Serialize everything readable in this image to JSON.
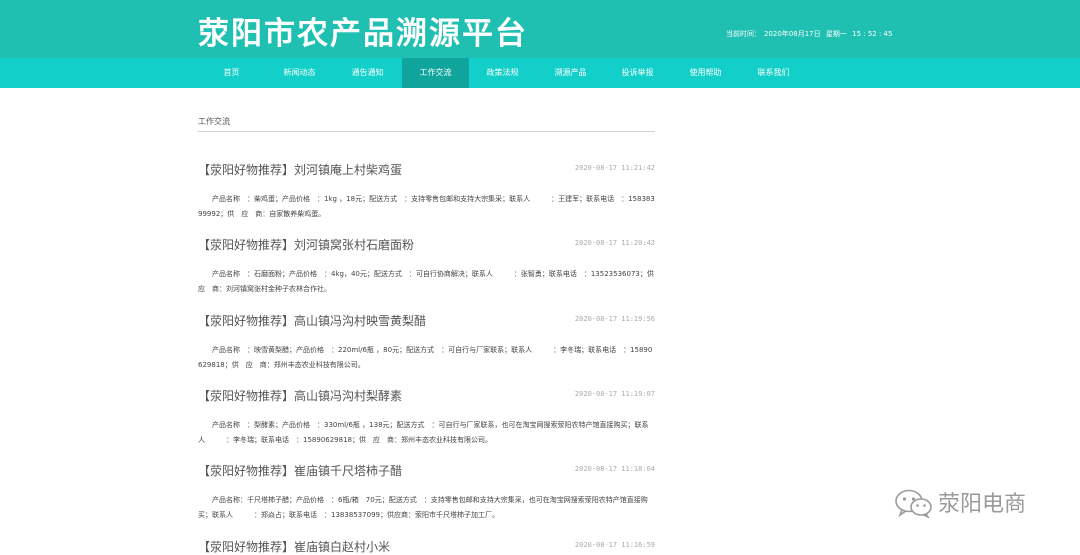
{
  "header": {
    "title": "荥阳市农产品溯源平台",
    "clock_label": "当前时间：",
    "clock_date": "2020年08月17日",
    "clock_weekday": "星期一",
    "clock_time": "15 : 52 : 45"
  },
  "nav": {
    "items": [
      {
        "label": "首页"
      },
      {
        "label": "新闻动态"
      },
      {
        "label": "通告通知"
      },
      {
        "label": "工作交流",
        "active": true
      },
      {
        "label": "政策法规"
      },
      {
        "label": "溯源产品"
      },
      {
        "label": "投诉举报"
      },
      {
        "label": "使用帮助"
      },
      {
        "label": "联系我们"
      }
    ]
  },
  "breadcrumb": "工作交流",
  "articles": [
    {
      "title": "【荥阳好物推荐】刘河镇庵上村柴鸡蛋",
      "time": "2020-08-17 11:21:42",
      "summary": "产品名称　：柴鸡蛋；产品价格　：1kg ，18元；配送方式　：支持零售包邮和支持大宗集采；联系人　　　：王建军；联系电话　：15838399992；供　应　商：自家散养柴鸡蛋。"
    },
    {
      "title": "【荥阳好物推荐】刘河镇窝张村石磨面粉",
      "time": "2020-08-17 11:20:42",
      "summary": "产品名称　：石磨面粉；产品价格　：4kg，40元；配送方式　：可自行协商解决；联系人　　　：张智勇；联系电话　：13523536073；供　应　商：刘河镇窝张村金种子农林合作社。"
    },
    {
      "title": "【荥阳好物推荐】高山镇冯沟村映雪黄梨醋",
      "time": "2020-08-17 11:19:56",
      "summary": "产品名称　：映雪黄梨醋；产品价格　：220ml/6瓶 ，80元；配送方式　：可自行与厂家联系；联系人　　　：李冬瑞；联系电话　：15890629818；供　应　商：郑州丰态农业科技有限公司。"
    },
    {
      "title": "【荥阳好物推荐】高山镇冯沟村梨酵素",
      "time": "2020-08-17 11:19:07",
      "summary": "产品名称　：梨酵素；产品价格　：330ml/6瓶 ，138元；配送方式　：可自行与厂家联系，也可在淘宝网搜索荥阳农特产馆直接购买；联系人　　　：李冬瑞；联系电话　：15890629818；供　应　商：郑州丰态农业科技有限公司。"
    },
    {
      "title": "【荥阳好物推荐】崔庙镇千尺塔柿子醋",
      "time": "2020-08-17 11:18:04",
      "summary": "产品名称：千尺塔柿子醋；产品价格　：6瓶/箱　70元；配送方式　：支持零售包邮和支持大宗集采，也可在淘宝网搜索荥阳农特产馆直接购买；联系人　　　：郑焱占；联系电话　：13838537099；供应商：荥阳市千尺塔柿子加工厂。"
    },
    {
      "title": "【荥阳好物推荐】崔庙镇白赵村小米",
      "time": "2020-08-17 11:16:59",
      "summary": ""
    }
  ],
  "watermark": {
    "text": "荥阳电商",
    "icon": "wechat-icon"
  },
  "colors": {
    "header_bg": "#1fbfb2",
    "nav_bg": "#13cfc9",
    "nav_active_bg": "#0fa59d"
  }
}
